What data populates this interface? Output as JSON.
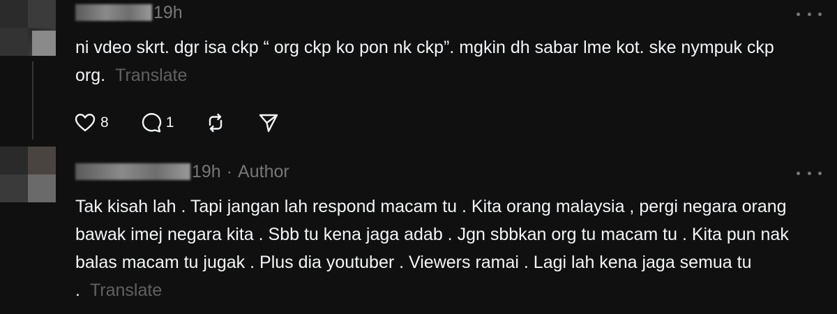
{
  "comments": [
    {
      "time": "19h",
      "text": "ni vdeo skrt. dgr isa ckp “ org ckp ko pon nk ckp”. mgkin dh sabar lme kot. ske nympuk ckp org.",
      "translate_label": "Translate",
      "likes": "8",
      "replies": "1"
    },
    {
      "time": "19h",
      "author_label": "Author",
      "separator": "·",
      "text": "Tak kisah lah . Tapi jangan lah respond macam tu . Kita orang malaysia , pergi negara orang bawak imej negara kita . Sbb tu kena jaga adab . Jgn sbbkan org tu macam tu . Kita pun nak balas macam tu jugak . Plus dia youtuber . Viewers ramai . Lagi lah kena jaga semua tu .",
      "translate_label": "Translate"
    }
  ],
  "icons": {
    "like": "heart-icon",
    "reply": "comment-icon",
    "repost": "repost-icon",
    "share": "send-icon",
    "more": "more-icon"
  }
}
